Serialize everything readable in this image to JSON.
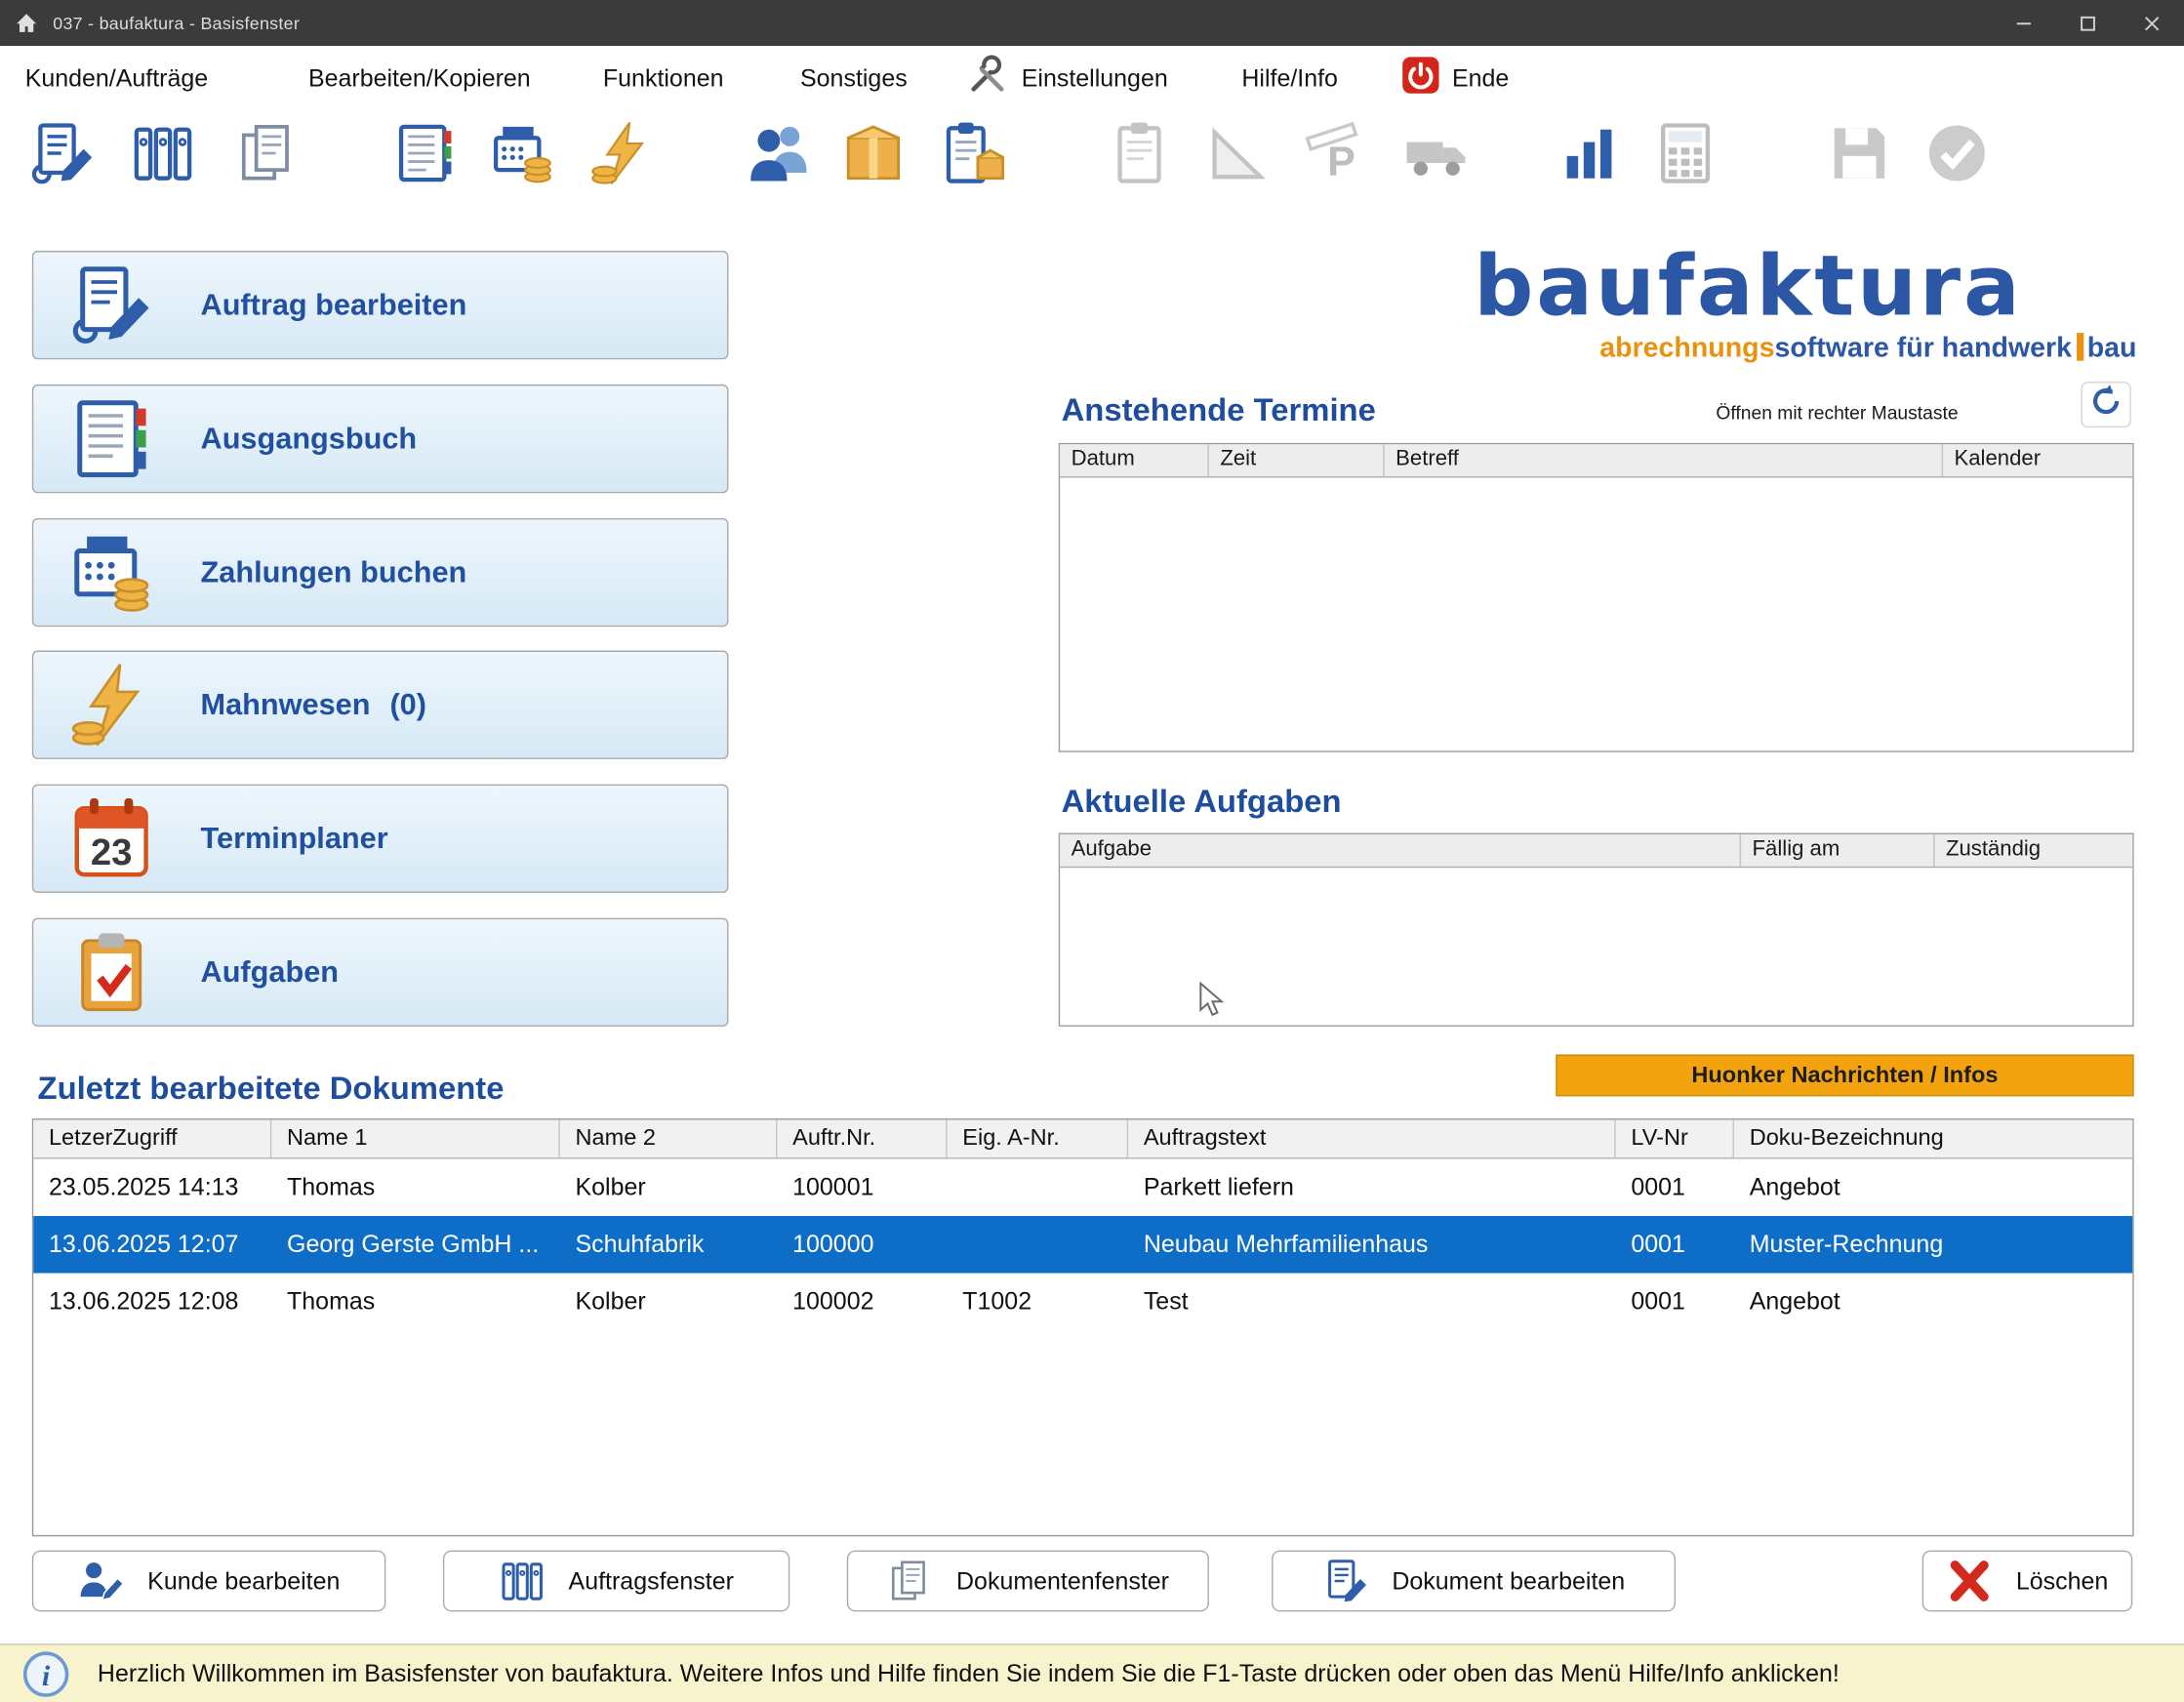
{
  "window": {
    "title": "037  -  baufaktura - Basisfenster"
  },
  "menu": {
    "items": [
      {
        "label": "Kunden/Aufträge"
      },
      {
        "label": "Bearbeiten/Kopieren"
      },
      {
        "label": "Funktionen"
      },
      {
        "label": "Sonstiges"
      },
      {
        "label": "Einstellungen",
        "icon": "tools-icon"
      },
      {
        "label": "Hilfe/Info"
      },
      {
        "label": "Ende",
        "icon": "power-icon"
      }
    ]
  },
  "toolbar": {
    "icons": [
      "edit-document-icon",
      "binders-icon",
      "copy-documents-icon",
      "ledger-icon",
      "cash-register-icon",
      "dunning-icon",
      "customers-icon",
      "package-icon",
      "delivery-note-icon",
      "clipboard-icon",
      "set-square-icon",
      "plan-p-icon",
      "truck-icon",
      "statistics-icon",
      "calculator-icon",
      "save-icon",
      "approve-icon"
    ]
  },
  "sidebar": {
    "buttons": [
      {
        "label": "Auftrag bearbeiten",
        "icon": "edit-order-icon"
      },
      {
        "label": "Ausgangsbuch",
        "icon": "ledger-icon"
      },
      {
        "label": "Zahlungen buchen",
        "icon": "cash-register-icon"
      },
      {
        "label": "Mahnwesen",
        "count": "(0)",
        "icon": "dunning-icon"
      },
      {
        "label": "Terminplaner",
        "icon": "calendar-icon",
        "calendar_day": "23"
      },
      {
        "label": "Aufgaben",
        "icon": "tasks-icon"
      }
    ]
  },
  "logo": {
    "name": "baufaktura",
    "tagline_part1": "abrechnungs",
    "tagline_part2": "software für handwerk",
    "tagline_part3": "bau"
  },
  "termine": {
    "title": "Anstehende Termine",
    "hint": "Öffnen mit rechter Maustaste",
    "columns": [
      "Datum",
      "Zeit",
      "Betreff",
      "Kalender"
    ],
    "rows": []
  },
  "aufgaben": {
    "title": "Aktuelle Aufgaben",
    "columns": [
      "Aufgabe",
      "Fällig am",
      "Zuständig"
    ],
    "rows": []
  },
  "news_button": {
    "label": "Huonker Nachrichten  /  Infos"
  },
  "documents": {
    "title": "Zuletzt bearbeitete Dokumente",
    "columns": [
      "LetzerZugriff",
      "Name 1",
      "Name 2",
      "Auftr.Nr.",
      "Eig. A-Nr.",
      "Auftragstext",
      "LV-Nr",
      "Doku-Bezeichnung"
    ],
    "rows": [
      {
        "zugriff": "23.05.2025 14:13",
        "name1": "Thomas",
        "name2": "Kolber",
        "auftrnr": "100001",
        "eignr": "",
        "text": "Parkett liefern",
        "lvnr": "0001",
        "doku": "Angebot",
        "selected": false
      },
      {
        "zugriff": "13.06.2025 12:07",
        "name1": "Georg Gerste GmbH ...",
        "name2": "Schuhfabrik",
        "auftrnr": "100000",
        "eignr": "",
        "text": "Neubau Mehrfamilienhaus",
        "lvnr": "0001",
        "doku": "Muster-Rechnung",
        "selected": true
      },
      {
        "zugriff": "13.06.2025 12:08",
        "name1": "Thomas",
        "name2": "Kolber",
        "auftrnr": "100002",
        "eignr": "T1002",
        "text": "Test",
        "lvnr": "0001",
        "doku": "Angebot",
        "selected": false
      }
    ]
  },
  "footer_buttons": [
    {
      "label": "Kunde bearbeiten",
      "icon": "customer-edit-icon"
    },
    {
      "label": "Auftragsfenster",
      "icon": "orders-icon"
    },
    {
      "label": "Dokumentenfenster",
      "icon": "documents-icon"
    },
    {
      "label": "Dokument bearbeiten",
      "icon": "document-edit-icon"
    },
    {
      "label": "Löschen",
      "icon": "delete-icon"
    }
  ],
  "statusbar": {
    "message": "Herzlich Willkommen im Basisfenster von baufaktura. Weitere Infos und Hilfe finden Sie indem Sie die F1-Taste drücken oder oben das Menü Hilfe/Info anklicken!"
  },
  "colors": {
    "accent_blue": "#2150a0",
    "selection_blue": "#0d6dc7",
    "news_orange": "#f2a30e",
    "status_yellow": "#f6f3cd",
    "titlebar_gray": "#3b3b3b"
  }
}
